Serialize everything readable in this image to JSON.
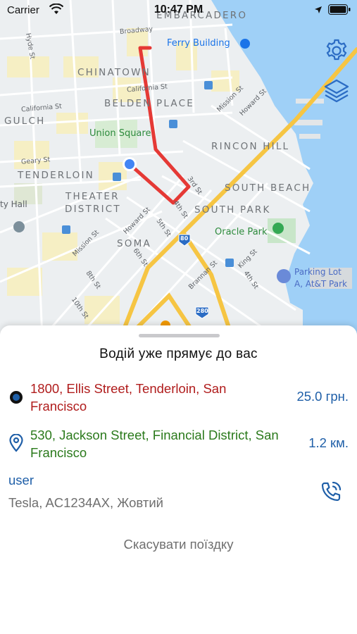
{
  "status_bar": {
    "carrier": "Carrier",
    "time": "10:47 PM"
  },
  "map": {
    "districts": [
      "EMBARCADERO",
      "CHINATOWN",
      "BELDEN PLACE",
      "GULCH",
      "RINCON HILL",
      "TENDERLOIN",
      "THEATER",
      "DISTRICT",
      "SOUTH BEACH",
      "SOUTH PARK",
      "SOMA"
    ],
    "pois": {
      "ferry_building": "Ferry Building",
      "union_square": "Union Square",
      "oracle_park": "Oracle Park",
      "parking_lot_a": "Parking Lot",
      "parking_lot_b": "A, At&T Park",
      "city_hall": "ty Hall"
    },
    "streets": [
      "Broadway",
      "Hyde St",
      "California St",
      "California St",
      "Mission St",
      "Howard St",
      "Geary St",
      "3rd St",
      "4th St",
      "Howard St",
      "5th St",
      "Mission St",
      "6th St",
      "Brannan St",
      "8th St",
      "10th St",
      "King St",
      "4th St"
    ],
    "highways": [
      "80",
      "280"
    ],
    "colors": {
      "route": "#e53935",
      "water": "#9fd0f7",
      "park": "#c8e6c9",
      "highway": "#f6c543"
    }
  },
  "controls": {
    "settings_icon": "gear-icon",
    "layers_icon": "layers-icon"
  },
  "ride": {
    "title": "Водій уже прямує до вас",
    "pickup_address": "1800, Ellis Street, Tenderloin, San Francisco",
    "price": "25.0 грн.",
    "destination_address": "530, Jackson Street, Financial District, San Francisco",
    "distance": "1.2 км.",
    "driver_name": "user",
    "car": "Tesla, AC1234AX, Жовтий",
    "cancel_label": "Скасувати поїздку",
    "colors": {
      "pickup": "#b01c1c",
      "destination": "#2b7a1c",
      "accent": "#1f5fa8"
    }
  }
}
